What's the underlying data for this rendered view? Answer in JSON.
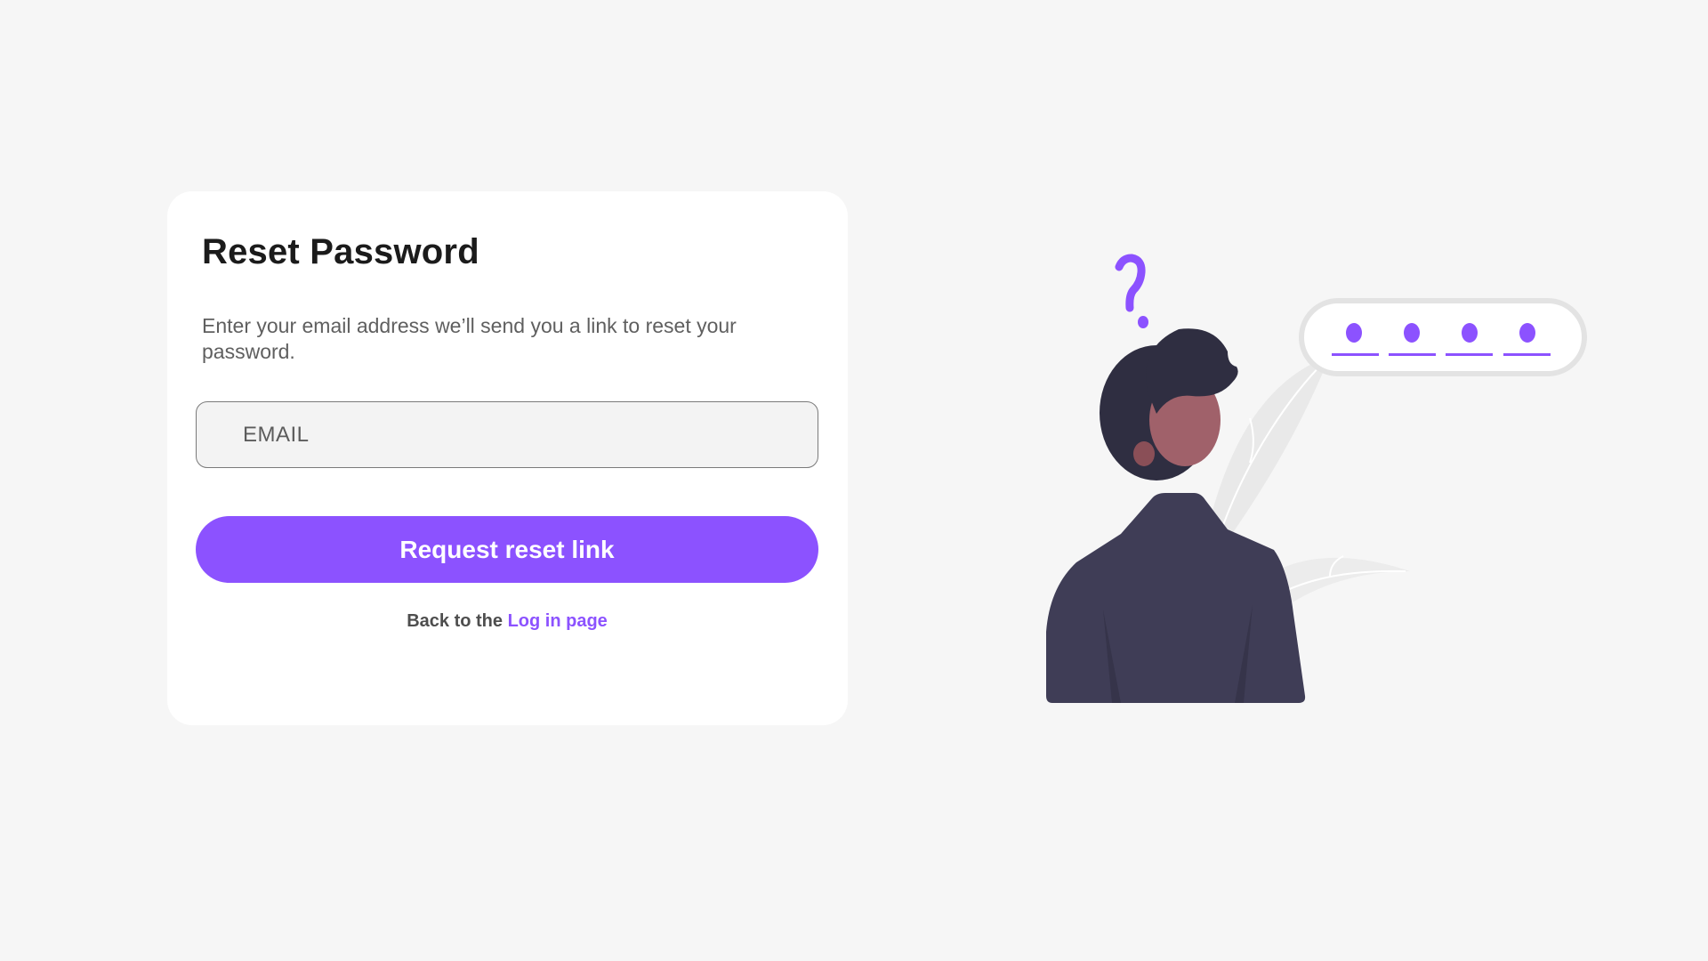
{
  "form": {
    "title": "Reset Password",
    "description": "Enter your email address we’ll send you a link to reset your password.",
    "email_placeholder": "EMAIL",
    "email_value": "",
    "submit_label": "Request reset link",
    "back_prefix": "Back to the",
    "back_link_label": "Log in page"
  },
  "illustration": {
    "question_mark": "?",
    "icons": [
      "question-mark-icon",
      "password-dots-icon",
      "person-illustration",
      "leaf-illustration"
    ]
  },
  "colors": {
    "background": "#f6f6f6",
    "card": "#ffffff",
    "accent": "#8c52ff",
    "title": "#1b1b1b",
    "body_text": "#5f5f5f",
    "jacket": "#3f3d56",
    "hair": "#2f2e41",
    "skin": "#a0616a"
  }
}
